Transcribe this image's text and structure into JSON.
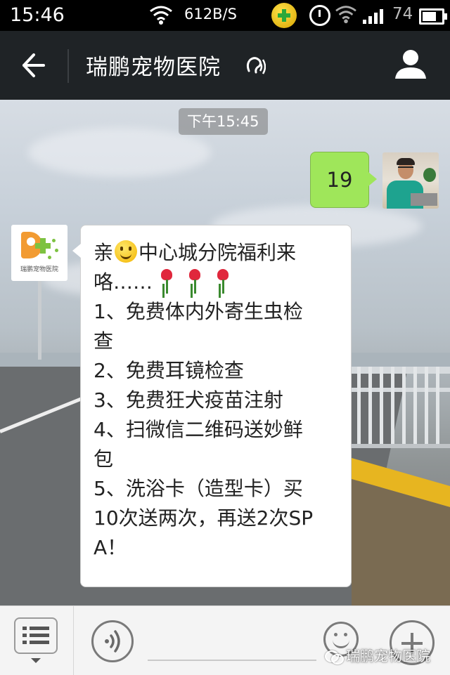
{
  "status_bar": {
    "time": "15:46",
    "net_speed": "612B/S",
    "battery_level": "74",
    "icons": [
      "wifi-icon",
      "360-security-icon",
      "alarm-icon",
      "wifi-icon",
      "signal-icon",
      "battery-icon"
    ]
  },
  "header": {
    "title": "瑞鹏宠物医院",
    "icons": [
      "back-arrow-icon",
      "earpiece-icon",
      "profile-icon"
    ]
  },
  "chat": {
    "timestamp": "下午15:45",
    "messages": [
      {
        "sender": "self",
        "text": "19"
      },
      {
        "sender": "hospital",
        "avatar_text": "瑞鹏宠物医院",
        "lines": {
          "l1_a": "亲",
          "l1_b": "中心城分院福利来",
          "l2": "咯……",
          "l3": "1、免费体内外寄生虫检",
          "l4": "查",
          "l5": "2、免费耳镜检查",
          "l6": "3、免费狂犬疫苗注射",
          "l7": "4、扫微信二维码送妙鲜",
          "l8": "包",
          "l9": "5、洗浴卡（造型卡）买",
          "l10": "10次送两次，再送2次SP",
          "l11": "A！"
        },
        "emojis": [
          "smiley-emoji",
          "rose-emoji",
          "rose-emoji",
          "rose-emoji"
        ]
      }
    ]
  },
  "input_bar": {
    "icons": [
      "menu-list-icon",
      "voice-icon",
      "emoji-icon",
      "plus-icon"
    ],
    "input_value": ""
  },
  "watermark": {
    "text": "瑞鹏宠物医院"
  },
  "colors": {
    "header_bg": "#1f2326",
    "self_bubble": "#9fe65a",
    "other_bubble": "#ffffff",
    "logo_orange": "#f29b32",
    "logo_green": "#7dc241"
  }
}
